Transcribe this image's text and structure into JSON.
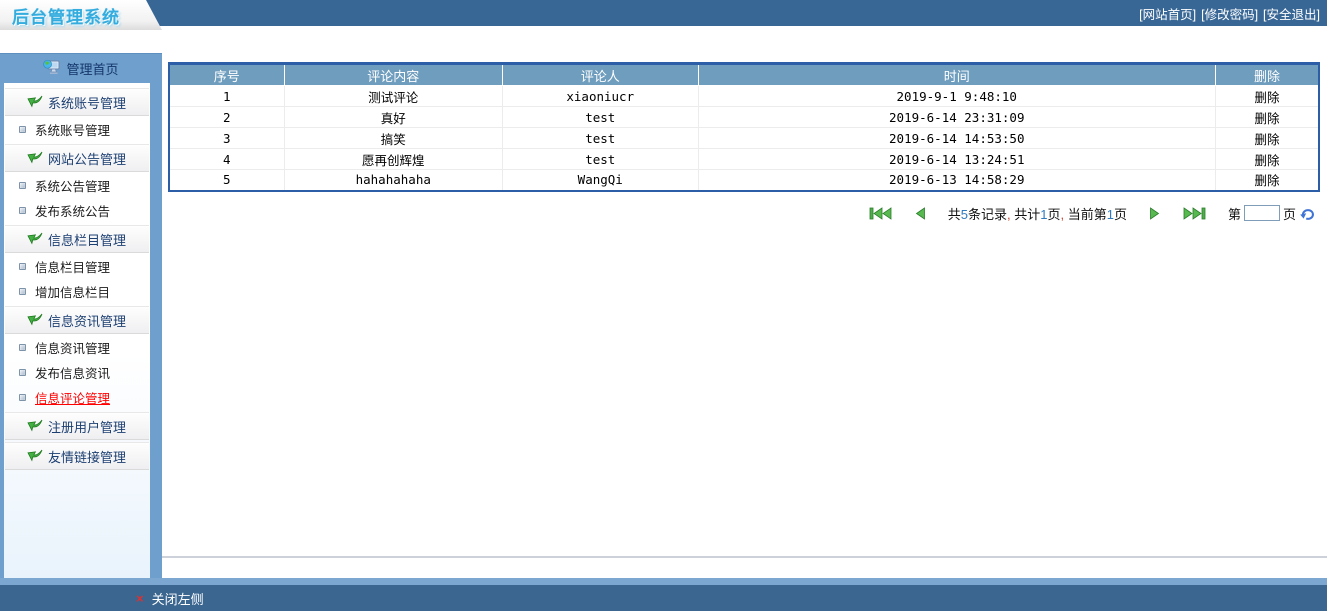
{
  "topbar": {
    "logo_text": "后台管理系统",
    "links": [
      {
        "id": "site-home",
        "label": "[网站首页]"
      },
      {
        "id": "change-password",
        "label": "[修改密码]"
      },
      {
        "id": "safe-logout",
        "label": "[安全退出]"
      }
    ]
  },
  "sidebar": {
    "home": {
      "icon": "computer-globe-icon",
      "label": "管理首页"
    },
    "items": [
      {
        "type": "category",
        "icon": "green-arrow-icon",
        "label": "系统账号管理"
      },
      {
        "type": "link",
        "icon": "square-bullet-icon",
        "label": "系统账号管理"
      },
      {
        "type": "category",
        "icon": "green-arrow-icon",
        "label": "网站公告管理"
      },
      {
        "type": "link",
        "icon": "square-bullet-icon",
        "label": "系统公告管理"
      },
      {
        "type": "link",
        "icon": "square-bullet-icon",
        "label": "发布系统公告"
      },
      {
        "type": "category",
        "icon": "green-arrow-icon",
        "label": "信息栏目管理"
      },
      {
        "type": "link",
        "icon": "square-bullet-icon",
        "label": "信息栏目管理"
      },
      {
        "type": "link",
        "icon": "square-bullet-icon",
        "label": "增加信息栏目"
      },
      {
        "type": "category",
        "icon": "green-arrow-icon",
        "label": "信息资讯管理"
      },
      {
        "type": "link",
        "icon": "square-bullet-icon",
        "label": "信息资讯管理"
      },
      {
        "type": "link",
        "icon": "square-bullet-icon",
        "label": "发布信息资讯"
      },
      {
        "type": "link",
        "icon": "square-bullet-icon",
        "label": "信息评论管理",
        "active": true
      },
      {
        "type": "category",
        "icon": "green-arrow-icon",
        "label": "注册用户管理"
      },
      {
        "type": "category",
        "icon": "green-arrow-icon",
        "label": "友情链接管理"
      }
    ]
  },
  "table": {
    "columns": [
      {
        "key": "no",
        "label": "序号",
        "width": "10%"
      },
      {
        "key": "content",
        "label": "评论内容",
        "width": "19%"
      },
      {
        "key": "user",
        "label": "评论人",
        "width": "17%"
      },
      {
        "key": "time",
        "label": "时间",
        "width": "45%"
      },
      {
        "key": "action",
        "label": "删除",
        "width": "9%"
      }
    ],
    "rows": [
      {
        "no": "1",
        "content": "测试评论",
        "user": "xiaoniucr",
        "time": "2019-9-1 9:48:10",
        "action": "删除"
      },
      {
        "no": "2",
        "content": "真好",
        "user": "test",
        "time": "2019-6-14 23:31:09",
        "action": "删除"
      },
      {
        "no": "3",
        "content": "搞笑",
        "user": "test",
        "time": "2019-6-14 14:53:50",
        "action": "删除"
      },
      {
        "no": "4",
        "content": "愿再创辉煌",
        "user": "test",
        "time": "2019-6-14 13:24:51",
        "action": "删除"
      },
      {
        "no": "5",
        "content": "hahahahaha",
        "user": "WangQi",
        "time": "2019-6-13 14:58:29",
        "action": "删除"
      }
    ]
  },
  "pagination": {
    "first_icon": "first-page-icon",
    "prev_icon": "prev-page-icon",
    "next_icon": "next-page-icon",
    "last_icon": "last-page-icon",
    "go_icon": "go-page-icon",
    "summary_parts": [
      {
        "text": "共"
      },
      {
        "text": "5",
        "style": "num"
      },
      {
        "text": "条记录"
      },
      {
        "text": ",",
        "style": "comma"
      },
      {
        "text": " 共计"
      },
      {
        "text": "1",
        "style": "num"
      },
      {
        "text": "页"
      },
      {
        "text": ",",
        "style": "comma"
      },
      {
        "text": " 当前第"
      },
      {
        "text": "1",
        "style": "num"
      },
      {
        "text": "页"
      }
    ],
    "goto_prefix": "第",
    "goto_suffix": "页",
    "page_input_value": ""
  },
  "footer": {
    "close_icon": "×",
    "close_label": "关闭左侧"
  },
  "colors": {
    "topbar_blue": "#386796",
    "panel_blue": "#6f9fcc",
    "table_header_blue": "#6f9dbe",
    "table_border_blue": "#2b5ea7",
    "bottombar_blue": "#3a6690",
    "logo_cyan": "#35acde",
    "accent_green": "#44b044",
    "active_red": "#ff0000",
    "number_blue": "#2f7bc0",
    "comma_red": "#cc4433"
  }
}
